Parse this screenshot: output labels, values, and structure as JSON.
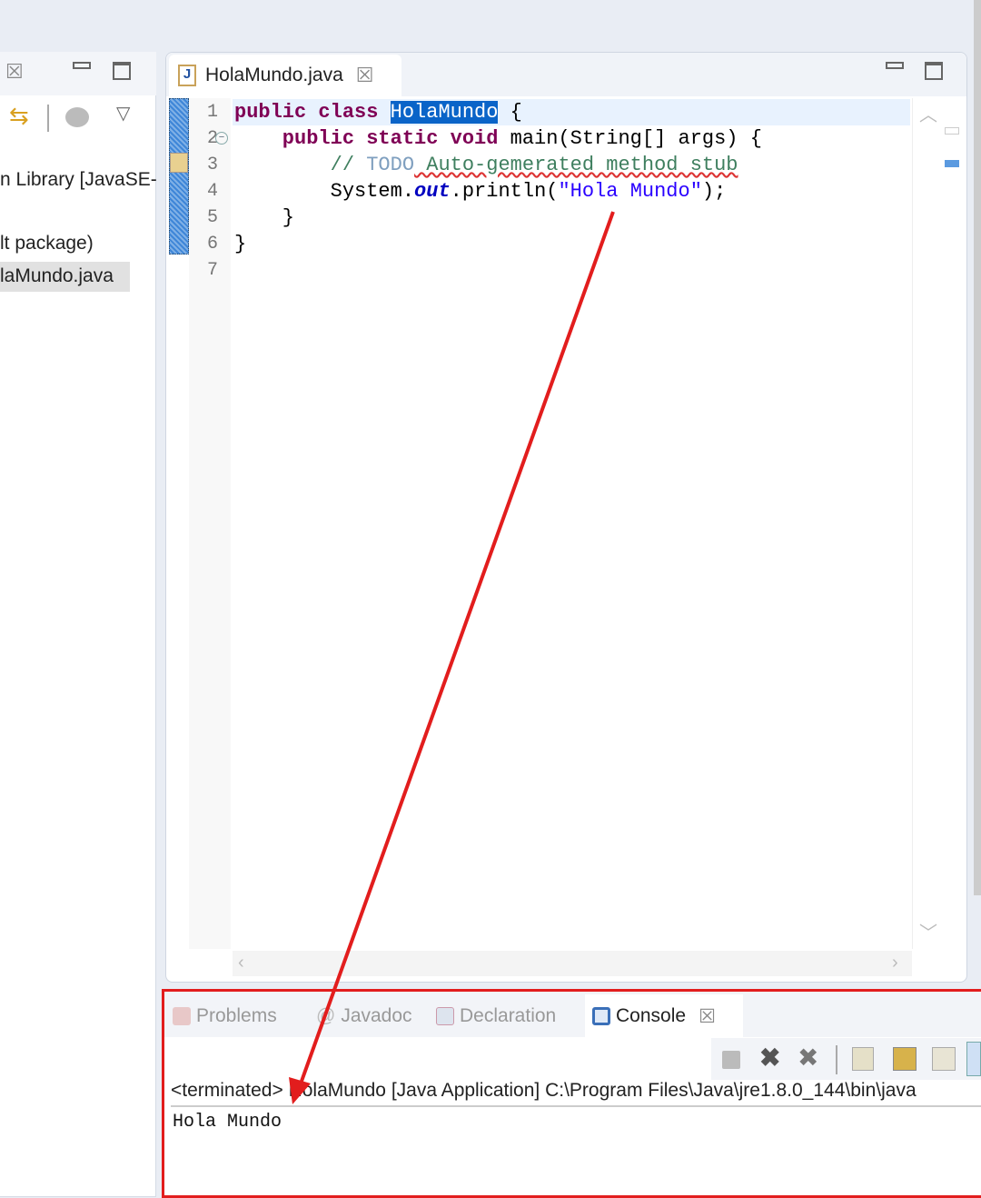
{
  "explorer": {
    "items": [
      "n Library [JavaSE-",
      "lt package)",
      "laMundo.java"
    ]
  },
  "editor": {
    "tab_label": "HolaMundo.java",
    "close_glyph": "☒",
    "line_numbers": [
      "1",
      "2",
      "3",
      "4",
      "5",
      "6",
      "7"
    ],
    "lines": [
      [
        {
          "t": "public class ",
          "c": "kw"
        },
        {
          "t": "HolaMundo",
          "c": "sel"
        },
        {
          "t": " {",
          "c": ""
        }
      ],
      [
        {
          "t": "    public static void ",
          "c": "kw"
        },
        {
          "t": "main(String[] args) {",
          "c": ""
        }
      ],
      [
        {
          "t": "        // ",
          "c": "cm"
        },
        {
          "t": "TODO",
          "c": "todo"
        },
        {
          "t": " Auto-gemerated method stub",
          "c": "cm"
        }
      ],
      [
        {
          "t": "        System.",
          "c": ""
        },
        {
          "t": "out",
          "c": "fld"
        },
        {
          "t": ".println(",
          "c": ""
        },
        {
          "t": "\"Hola Mundo\"",
          "c": "str"
        },
        {
          "t": ");",
          "c": ""
        }
      ],
      [
        {
          "t": "    }",
          "c": ""
        }
      ],
      [
        {
          "t": "}",
          "c": ""
        }
      ],
      [
        {
          "t": "",
          "c": ""
        }
      ]
    ]
  },
  "bottom": {
    "tabs": [
      {
        "label": "Problems",
        "icon": "problems-icon"
      },
      {
        "label": "Javadoc",
        "icon": "javadoc-icon"
      },
      {
        "label": "Declaration",
        "icon": "declaration-icon"
      },
      {
        "label": "Console",
        "icon": "console-icon",
        "active": true
      }
    ],
    "console_header": "<terminated> HolaMundo [Java Application] C:\\Program Files\\Java\\jre1.8.0_144\\bin\\java",
    "console_output": "Hola Mundo"
  },
  "colors": {
    "annotation": "#e21d1d",
    "selection": "#0a64c8"
  }
}
